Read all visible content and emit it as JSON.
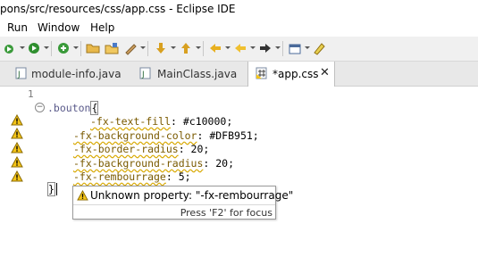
{
  "window": {
    "title": "pons/src/resources/css/app.css - Eclipse IDE"
  },
  "menu": {
    "items": [
      "Run",
      "Window",
      "Help"
    ]
  },
  "toolbar": {
    "buttons": [
      "debug-icon",
      "run-icon",
      "new-icon",
      "open-folder-icon",
      "open-file-icon",
      "edit-icon",
      "next-annotation-icon",
      "previous-annotation-icon",
      "back-icon",
      "forward-icon",
      "new-window-icon",
      "highlight-icon"
    ]
  },
  "tabs": [
    {
      "label": "module-info.java",
      "icon": "java-file-icon",
      "active": false
    },
    {
      "label": "MainClass.java",
      "icon": "java-file-icon",
      "active": false
    },
    {
      "label": "*app.css",
      "icon": "css-file-icon",
      "active": true,
      "close": "✕"
    }
  ],
  "editor": {
    "line_number": "1",
    "fold_symbol": "−",
    "lines": [
      {
        "selector": ".bouton",
        "brace": "{"
      },
      {
        "property": "-fx-text-fill",
        "value": ": #c10000;"
      },
      {
        "property": "-fx-background-color",
        "value": ": #DFB951;"
      },
      {
        "property": "-fx-border-radius",
        "value": ": 20;"
      },
      {
        "property": "-fx-background-radius",
        "value": ": 20;"
      },
      {
        "property": "-fx-rembourrage",
        "value": ": 5;"
      },
      {
        "brace": "}"
      }
    ],
    "warning_count": 5
  },
  "tooltip": {
    "message": "Unknown property: \"-fx-rembourrage\"",
    "hint": "Press 'F2' for focus"
  },
  "colors": {
    "warning": "#f5c518",
    "tab_active_bg": "#ffffff",
    "toolbar_bg": "#f0f0f0"
  }
}
